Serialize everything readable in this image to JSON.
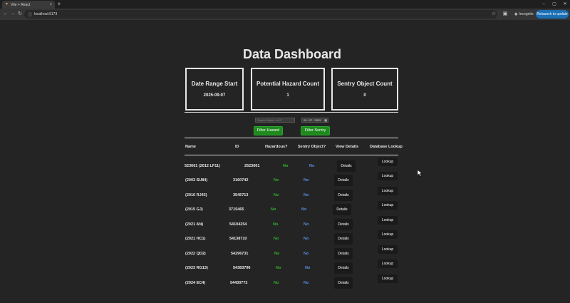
{
  "browser": {
    "tab_title": "Vite + React",
    "url": "localhost:5173",
    "incognito_label": "Incognito",
    "update_label": "Relaunch to update"
  },
  "page": {
    "title": "Data Dashboard"
  },
  "cards": [
    {
      "title": "Date Range Start",
      "value": "2025-09-07"
    },
    {
      "title": "Potential Hazard Count",
      "value": "1"
    },
    {
      "title": "Sentry Object Count",
      "value": "0"
    }
  ],
  "filters": {
    "search_placeholder": "Search Name or ID",
    "date_value": "09 / 07 / 2025",
    "filter_hazard_label": "Filter Hazard",
    "filter_sentry_label": "Filter Sentry"
  },
  "table": {
    "headers": [
      "Name",
      "ID",
      "Hazardous?",
      "Sentry Object?",
      "View Details",
      "Database Lookup"
    ],
    "details_label": "Details",
    "lookup_label": "Lookup",
    "rows": [
      {
        "name": "523661 (2012 LF11)",
        "id": "2523661",
        "hazardous": "No",
        "sentry": "No"
      },
      {
        "name": "(2003 SU84)",
        "id": "3160742",
        "hazardous": "No",
        "sentry": "No"
      },
      {
        "name": "(2010 RJ43)",
        "id": "3545713",
        "hazardous": "No",
        "sentry": "No"
      },
      {
        "name": "(2015 GJ)",
        "id": "3715465",
        "hazardous": "No",
        "sentry": "No"
      },
      {
        "name": "(2021 AN)",
        "id": "54104254",
        "hazardous": "No",
        "sentry": "No"
      },
      {
        "name": "(2021 HC1)",
        "id": "54138710",
        "hazardous": "No",
        "sentry": "No"
      },
      {
        "name": "(2022 QD2)",
        "id": "54296731",
        "hazardous": "No",
        "sentry": "No"
      },
      {
        "name": "(2023 RG13)",
        "id": "54383796",
        "hazardous": "No",
        "sentry": "No"
      },
      {
        "name": "(2024 EC4)",
        "id": "54430772",
        "hazardous": "No",
        "sentry": "No"
      }
    ]
  },
  "colors": {
    "hazard_no": "#2fb52f",
    "sentry_no": "#5a8fe6",
    "filter_button": "#1e8a1e"
  }
}
